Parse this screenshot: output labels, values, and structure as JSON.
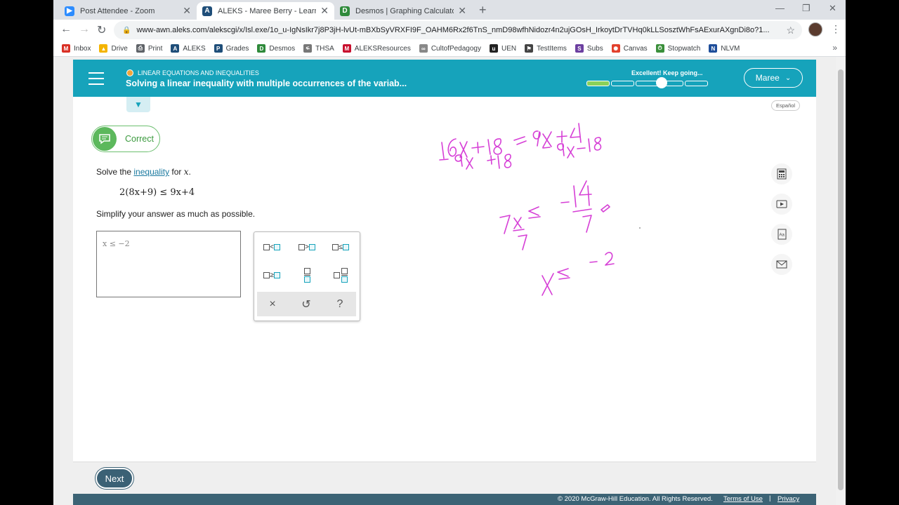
{
  "browser": {
    "tabs": [
      {
        "title": "Post Attendee - Zoom",
        "icon": "zoom-icon",
        "color": "#2d8cff"
      },
      {
        "title": "ALEKS - Maree Berry - Learn",
        "icon": "aleks-icon",
        "color": "#1f4e79"
      },
      {
        "title": "Desmos | Graphing Calculator",
        "icon": "desmos-icon",
        "color": "#2f8a3b"
      }
    ],
    "url": "www-awn.aleks.com/alekscgi/x/Isl.exe/1o_u-IgNsIkr7j8P3jH-lvUt-mBXbSyVRXFI9F_OAHM6Rx2f6TnS_nmD98wfhNidozr4n2ujGOsH_IrkoytDrTVHq0kLLSosztWhFsAExurAXgnDi8o?1...",
    "bookmarks": [
      {
        "label": "Inbox",
        "icon": "gmail-icon",
        "color": "#d93025",
        "glyph": "M"
      },
      {
        "label": "Drive",
        "icon": "drive-icon",
        "color": "#f4b400",
        "glyph": "▲"
      },
      {
        "label": "Print",
        "icon": "printer-icon",
        "color": "#5f6368",
        "glyph": "⎙"
      },
      {
        "label": "ALEKS",
        "icon": "aleks-icon",
        "color": "#1f4e79",
        "glyph": "A"
      },
      {
        "label": "Grades",
        "icon": "grades-icon",
        "color": "#1f4e79",
        "glyph": "P"
      },
      {
        "label": "Desmos",
        "icon": "desmos-icon",
        "color": "#2f8a3b",
        "glyph": "D"
      },
      {
        "label": "THSA",
        "icon": "thsa-icon",
        "color": "#777777",
        "glyph": "ፍ"
      },
      {
        "label": "ALEKSResources",
        "icon": "mcgraw-icon",
        "color": "#c8102e",
        "glyph": "M"
      },
      {
        "label": "CultofPedagogy",
        "icon": "link-icon",
        "color": "#888888",
        "glyph": "∞"
      },
      {
        "label": "UEN",
        "icon": "uen-icon",
        "color": "#222222",
        "glyph": "u"
      },
      {
        "label": "TestItems",
        "icon": "flag-icon",
        "color": "#444444",
        "glyph": "⚑"
      },
      {
        "label": "Subs",
        "icon": "subs-icon",
        "color": "#6c3fa0",
        "glyph": "S"
      },
      {
        "label": "Canvas",
        "icon": "canvas-icon",
        "color": "#e2402c",
        "glyph": "✺"
      },
      {
        "label": "Stopwatch",
        "icon": "stopwatch-icon",
        "color": "#3a8f3a",
        "glyph": "⏱"
      },
      {
        "label": "NLVM",
        "icon": "nlvm-icon",
        "color": "#1f4e9a",
        "glyph": "N"
      }
    ],
    "more": "»"
  },
  "header": {
    "topic": "LINEAR EQUATIONS AND INEQUALITIES",
    "lesson": "Solving a linear inequality with multiple occurrences of the variab...",
    "progress_message": "Excellent! Keep going...",
    "progress_filled_segments": 1,
    "progress_total_segments": 5,
    "user": "Maree",
    "language": "Español"
  },
  "status": {
    "label": "Correct"
  },
  "problem": {
    "prefix": "Solve the ",
    "link": "inequality",
    "for_text": " for ",
    "variable": "x",
    "period": ".",
    "equation": "2(8x+9) ≤ 9x+4",
    "instruction": "Simplify your answer as much as possible.",
    "answer": "x ≤ −2"
  },
  "keypad": {
    "clear": "×",
    "undo": "↺",
    "help": "?"
  },
  "footer": {
    "next": "Next",
    "copyright": "© 2020 McGraw-Hill Education. All Rights Reserved.",
    "terms": "Terms of Use",
    "separator": "|",
    "privacy": "Privacy"
  },
  "colors": {
    "brand": "#16a3bb",
    "correct": "#5cb85c",
    "ink": "#d63fd6",
    "next": "#3b6175"
  }
}
